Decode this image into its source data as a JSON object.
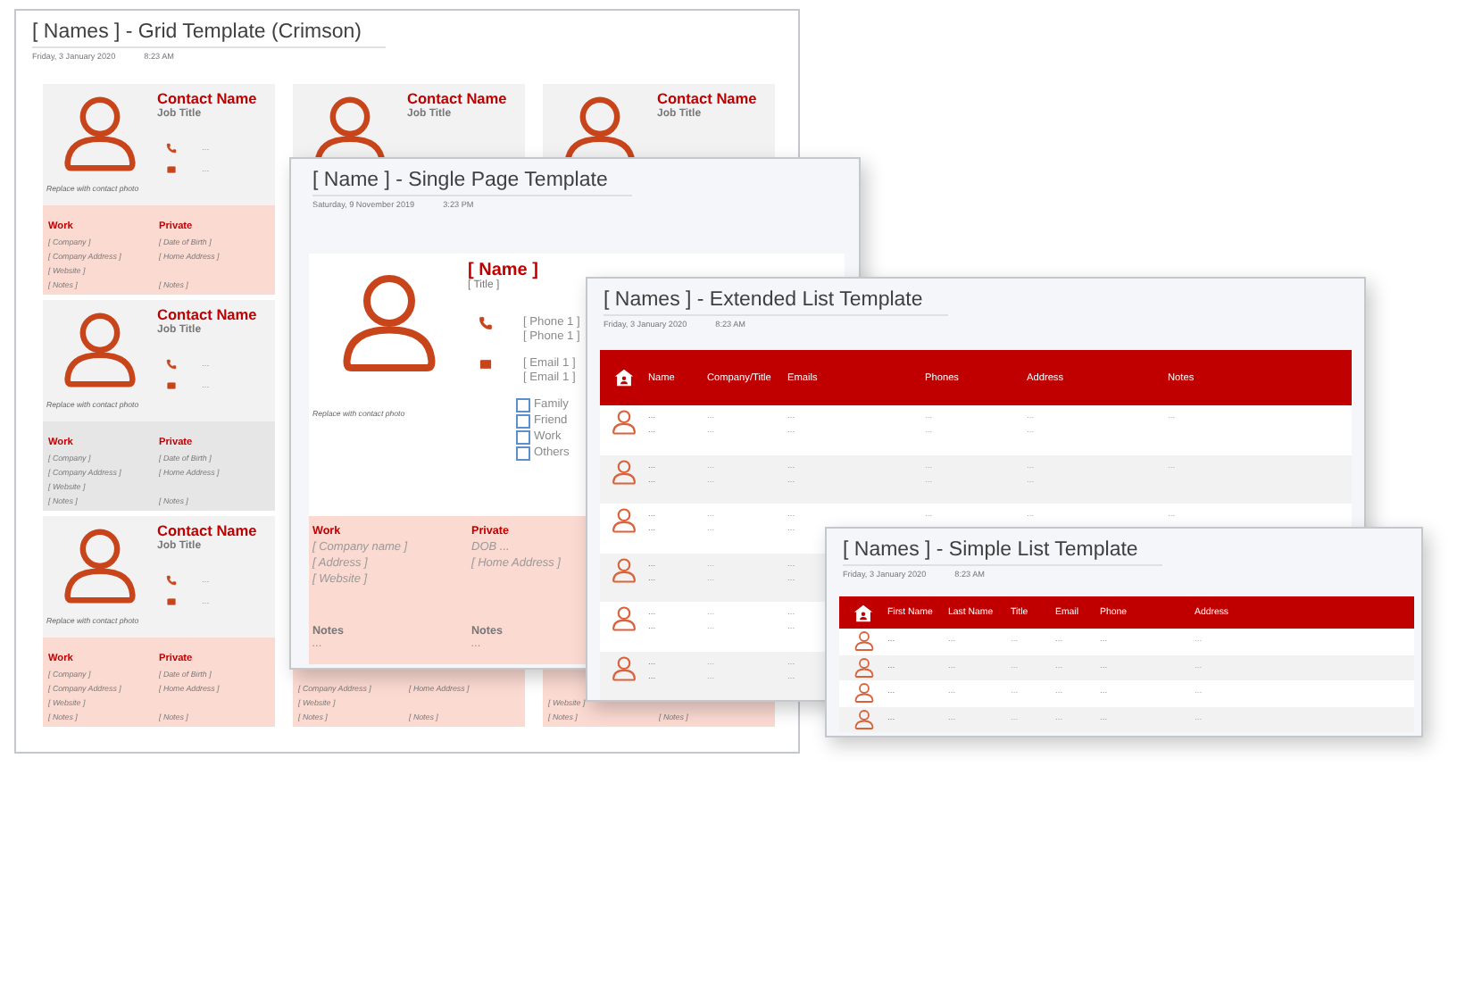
{
  "grid_window": {
    "title": "[ Names ] - Grid Template (Crimson)",
    "date": "Friday, 3 January 2020",
    "time": "8:23 AM",
    "columns": [
      {
        "cards": [
          {
            "kind": "full",
            "name": "Contact Name",
            "job_title": "Job Title",
            "phone": "...",
            "email": "...",
            "photo_caption": "Replace with contact photo",
            "color": "#fbdad2",
            "work_label": "Work",
            "private_label": "Private",
            "details": [
              {
                "work": "[ Company ]",
                "private": "[ Date of Birth ]"
              },
              {
                "work": "[ Company  Address ]",
                "private": "[ Home Address ]"
              },
              {
                "work": "[ Website ]"
              },
              {
                "work": "[ Notes ]",
                "private": "[ Notes ]"
              }
            ]
          },
          {
            "kind": "full",
            "name": "Contact Name",
            "job_title": "Job Title",
            "phone": "...",
            "email": "...",
            "photo_caption": "Replace with contact photo",
            "color": "#e6e6e6",
            "work_label": "Work",
            "private_label": "Private",
            "details": [
              {
                "work": "[ Company ]",
                "private": "[ Date of Birth ]"
              },
              {
                "work": "[ Company  Address ]",
                "private": "[ Home Address ]"
              },
              {
                "work": "[ Website ]"
              },
              {
                "work": "[ Notes ]",
                "private": "[ Notes ]"
              }
            ]
          },
          {
            "kind": "full",
            "name": "Contact Name",
            "job_title": "Job Title",
            "phone": "...",
            "email": "...",
            "photo_caption": "Replace with contact photo",
            "color": "#fbdad2",
            "work_label": "Work",
            "private_label": "Private",
            "details": [
              {
                "work": "[ Company ]",
                "private": "[ Date of Birth ]"
              },
              {
                "work": "[ Company  Address ]",
                "private": "[ Home Address ]"
              },
              {
                "work": "[ Website ]"
              },
              {
                "work": "[ Notes ]",
                "private": "[ Notes ]"
              }
            ]
          }
        ]
      },
      {
        "cards": [
          {
            "kind": "header",
            "name": "Contact Name",
            "job_title": "Job Title"
          },
          {
            "kind": "footer",
            "color": "#fbdad2",
            "details": [
              {
                "work": "[ Company Address ]",
                "private": "[ Home Address ]"
              },
              {
                "work": "[ Website ]"
              },
              {
                "work": "[ Notes ]",
                "private": "[ Notes ]"
              }
            ]
          }
        ]
      },
      {
        "cards": [
          {
            "kind": "header",
            "name": "Contact Name",
            "job_title": "Job Title"
          },
          {
            "kind": "footer",
            "color": "#fbdad2",
            "details": [
              {
                "work": "[ Website ]"
              },
              {
                "work": "[ Notes ]",
                "private": "[ Notes ]"
              }
            ]
          }
        ]
      }
    ]
  },
  "single_page_window": {
    "title": "[ Name ] - Single Page Template",
    "date": "Saturday, 9 November 2019",
    "time": "3:23 PM",
    "photo_caption": "Replace with contact photo",
    "name": "[ Name ]",
    "job_title": "[ Title ]",
    "phones": [
      "[ Phone 1 ]",
      "[ Phone 1 ]"
    ],
    "emails": [
      "[ Email 1 ]",
      "[ Email 1 ]"
    ],
    "groups": [
      {
        "label": "Family",
        "checked": false
      },
      {
        "label": "Friend",
        "checked": false
      },
      {
        "label": "Work",
        "checked": false
      },
      {
        "label": "Others",
        "checked": false
      }
    ],
    "work_label": "Work",
    "private_label": "Private",
    "work": [
      "[ Company name ]",
      "[ Address ]",
      "[ Website ]"
    ],
    "private": [
      "DOB ...",
      "[ Home Address ]"
    ],
    "notes": [
      {
        "label": "Notes",
        "value": "..."
      },
      {
        "label": "Notes",
        "value": "..."
      }
    ]
  },
  "extended_list_window": {
    "title": "[ Names ] - Extended List Template",
    "date": "Friday, 3 January 2020",
    "time": "8:23 AM",
    "columns": [
      "Name",
      "Company/Title",
      "Emails",
      "Phones",
      "Address",
      "Notes"
    ],
    "rows": [
      {
        "cells": [
          [
            "...",
            "..."
          ],
          [
            "...",
            "..."
          ],
          [
            "...",
            "..."
          ],
          [
            "...",
            "..."
          ],
          [
            "...",
            "..."
          ],
          [
            "..."
          ]
        ]
      },
      {
        "cells": [
          [
            "...",
            "..."
          ],
          [
            "...",
            "..."
          ],
          [
            "...",
            "..."
          ],
          [
            "...",
            "..."
          ],
          [
            "...",
            "..."
          ],
          [
            "..."
          ]
        ]
      },
      {
        "cells": [
          [
            "...",
            "..."
          ],
          [
            "...",
            "..."
          ],
          [
            "...",
            "..."
          ],
          [
            "..."
          ],
          [
            "..."
          ],
          [
            "..."
          ]
        ]
      },
      {
        "cells": [
          [
            "...",
            "..."
          ],
          [
            "...",
            "..."
          ],
          [
            "...",
            "..."
          ]
        ]
      },
      {
        "cells": [
          [
            "...",
            "..."
          ],
          [
            "...",
            "..."
          ],
          [
            "...",
            "..."
          ]
        ]
      },
      {
        "cells": [
          [
            "...",
            "..."
          ],
          [
            "...",
            "..."
          ],
          [
            "...",
            "..."
          ]
        ]
      }
    ]
  },
  "simple_list_window": {
    "title": "[ Names ] - Simple List Template",
    "date": "Friday, 3 January 2020",
    "time": "8:23 AM",
    "columns": [
      "First Name",
      "Last Name",
      "Title",
      "Email",
      "Phone",
      "Address"
    ],
    "rows": [
      {
        "cells": [
          "...",
          "...",
          "...",
          "...",
          "...",
          "..."
        ]
      },
      {
        "cells": [
          "...",
          "...",
          "...",
          "...",
          "...",
          "..."
        ]
      },
      {
        "cells": [
          "...",
          "...",
          "...",
          "...",
          "...",
          "..."
        ]
      },
      {
        "cells": [
          "...",
          "...",
          "...",
          "...",
          "...",
          "..."
        ]
      }
    ]
  }
}
